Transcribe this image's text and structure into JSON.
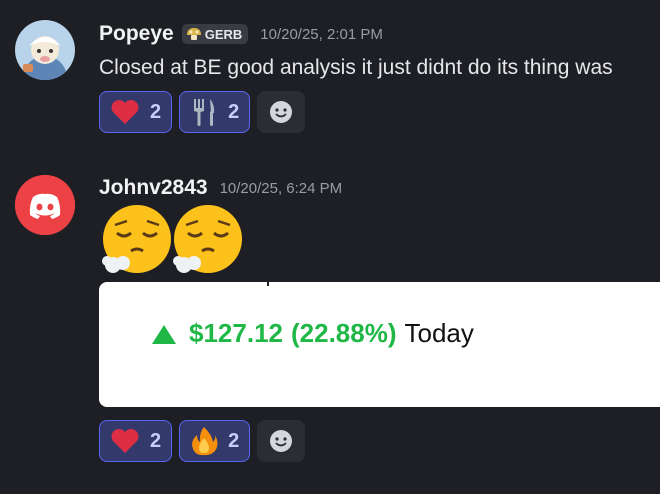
{
  "messages": [
    {
      "username": "Popeye",
      "tag": "GERB",
      "timestamp": "10/20/25, 2:01 PM",
      "content": "Closed at BE good analysis it just didnt do its thing was",
      "reactions": [
        {
          "emoji": "heart",
          "count": "2"
        },
        {
          "emoji": "fork-and-knife",
          "count": "2"
        }
      ]
    },
    {
      "username": "Johnv2843",
      "timestamp": "10/20/25, 6:24 PM",
      "emojis": [
        "face-exhaling",
        "face-exhaling"
      ],
      "embed": {
        "change": "$127.12",
        "percent": "(22.88%)",
        "period": "Today",
        "gain_color": "#1fb846"
      },
      "reactions": [
        {
          "emoji": "heart",
          "count": "2"
        },
        {
          "emoji": "fire",
          "count": "2"
        }
      ]
    }
  ],
  "colors": {
    "background": "#1e1f24",
    "reaction_bg": "#333a6b",
    "reaction_border": "#5865f2",
    "discord_red": "#ed4245"
  }
}
